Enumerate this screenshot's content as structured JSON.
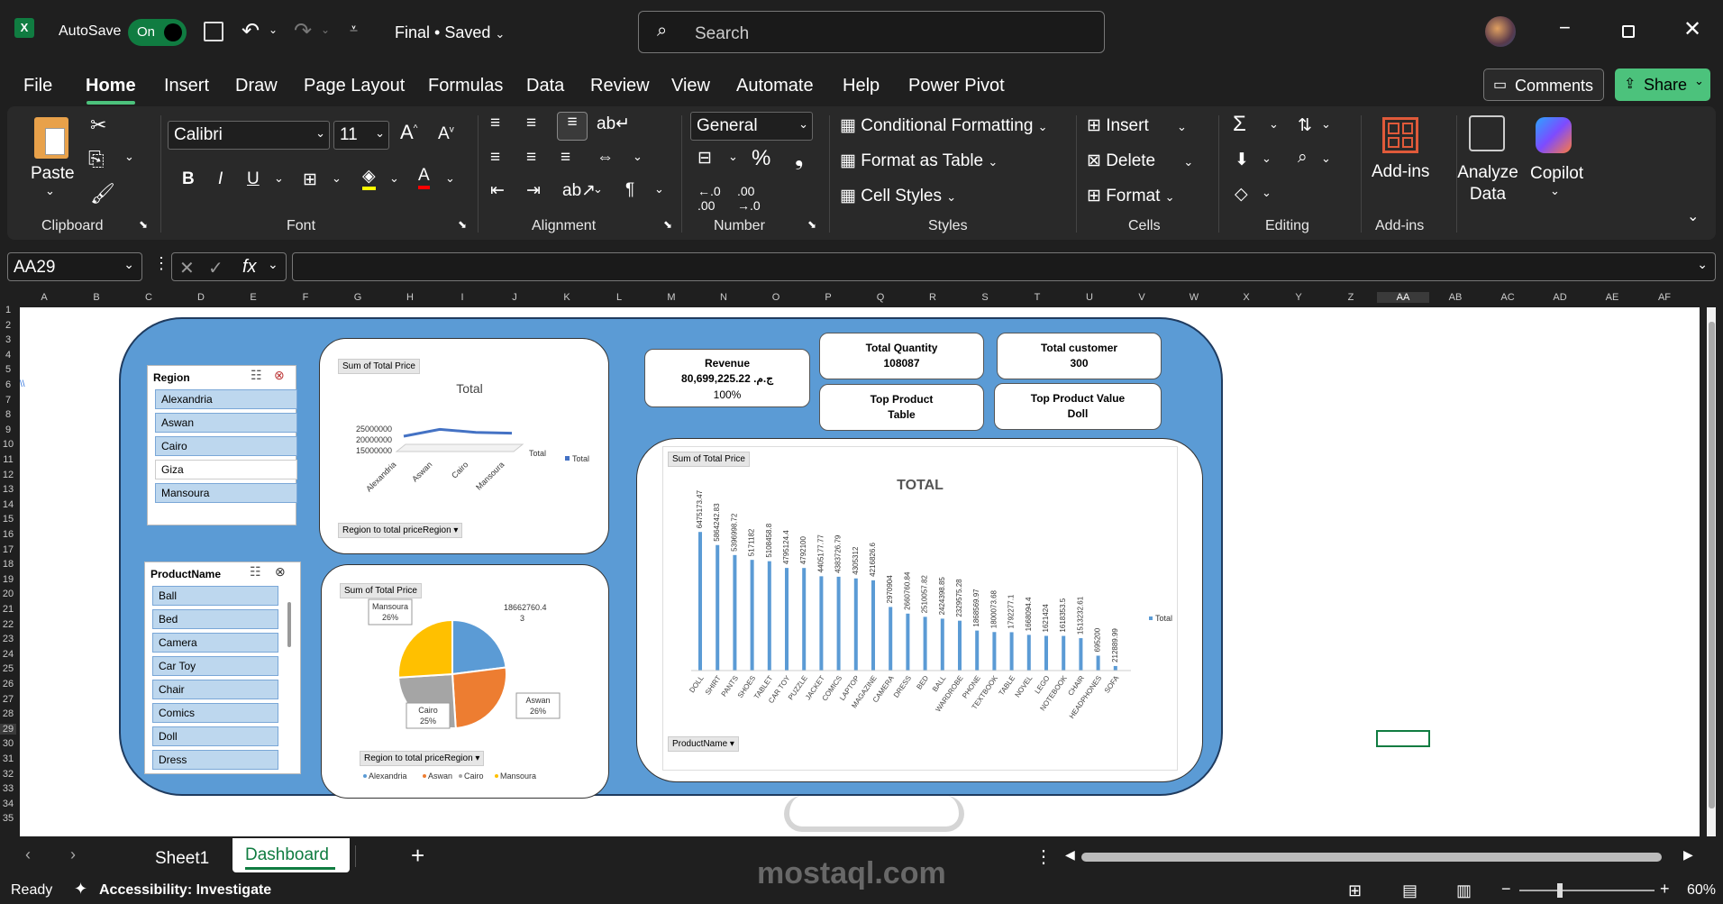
{
  "titlebar": {
    "autosave_label": "AutoSave",
    "toggle_state": "On",
    "doc_title": "Final • Saved",
    "search_placeholder": "Search"
  },
  "menu": [
    "File",
    "Home",
    "Insert",
    "Draw",
    "Page Layout",
    "Formulas",
    "Data",
    "Review",
    "View",
    "Automate",
    "Help",
    "Power Pivot"
  ],
  "menu_active": "Home",
  "actions": {
    "comments": "Comments",
    "share": "Share"
  },
  "ribbon": {
    "paste": "Paste",
    "font_name": "Calibri",
    "font_size": "11",
    "number_format": "General",
    "conditional_formatting": "Conditional Formatting",
    "format_as_table": "Format as Table",
    "cell_styles": "Cell Styles",
    "insert": "Insert",
    "delete": "Delete",
    "format": "Format",
    "add_ins": "Add-ins",
    "analyze_data": "Analyze Data",
    "copilot": "Copilot",
    "groups": {
      "clipboard": "Clipboard",
      "font": "Font",
      "alignment": "Alignment",
      "number": "Number",
      "styles": "Styles",
      "cells": "Cells",
      "editing": "Editing",
      "addins": "Add-ins"
    }
  },
  "formula_bar": {
    "name_box": "AA29",
    "fx": "fx",
    "formula": ""
  },
  "columns": [
    "A",
    "B",
    "C",
    "D",
    "E",
    "F",
    "G",
    "H",
    "I",
    "J",
    "K",
    "L",
    "M",
    "N",
    "O",
    "P",
    "Q",
    "R",
    "S",
    "T",
    "U",
    "V",
    "W",
    "X",
    "Y",
    "Z",
    "AA",
    "AB",
    "AC",
    "AD",
    "AE",
    "AF"
  ],
  "rows": [
    "1",
    "2",
    "3",
    "4",
    "5",
    "6",
    "7",
    "8",
    "9",
    "10",
    "11",
    "12",
    "13",
    "14",
    "15",
    "16",
    "17",
    "18",
    "19",
    "20",
    "21",
    "22",
    "23",
    "24",
    "25",
    "26",
    "27",
    "28",
    "29",
    "30",
    "31",
    "32",
    "33",
    "34",
    "35"
  ],
  "selected_cell": {
    "column": "AA",
    "row": "29"
  },
  "dashboard": {
    "region_slicer": {
      "title": "Region",
      "items": [
        "Alexandria",
        "Aswan",
        "Cairo",
        "Giza",
        "Mansoura"
      ],
      "selected": [
        "Alexandria",
        "Aswan",
        "Cairo",
        "Mansoura"
      ]
    },
    "product_slicer": {
      "title": "ProductName",
      "items": [
        "Ball",
        "Bed",
        "Camera",
        "Car Toy",
        "Chair",
        "Comics",
        "Doll",
        "Dress"
      ]
    },
    "kpis": {
      "revenue_label": "Revenue",
      "revenue_value": "80,699,225.22 ج.م.‏",
      "revenue_pct": "100%",
      "total_quantity_label": "Total Quantity",
      "total_quantity_value": "108087",
      "total_customer_label": "Total customer",
      "total_customer_value": "300",
      "top_product_label": "Top Product",
      "top_product_value": "Table",
      "top_product_value_label": "Top Product Value",
      "top_product_value_value": "Doll"
    },
    "line_chart_tag": "Sum of Total Price",
    "line_chart_filter": "Region to total priceRegion",
    "pie_chart_tag": "Sum of Total Price",
    "pie_chart_filter": "Region to total priceRegion",
    "bar_chart_tag": "Sum of Total Price",
    "bar_chart_filter": "ProductName"
  },
  "chart_data": [
    {
      "type": "line",
      "title": "Total",
      "categories": [
        "Alexandria",
        "Aswan",
        "Cairo",
        "Mansoura"
      ],
      "series": [
        {
          "name": "Total",
          "values": [
            18662760.43,
            21200000,
            20100000,
            19800000
          ]
        }
      ],
      "y_ticks": [
        "25000000",
        "20000000",
        "15000000"
      ],
      "ylim": [
        15000000,
        25000000
      ],
      "legend": "right",
      "color": "#4472c4"
    },
    {
      "type": "pie",
      "categories": [
        "Alexandria",
        "Aswan",
        "Cairo",
        "Mansoura"
      ],
      "values": [
        23,
        26,
        25,
        26
      ],
      "labels": [
        "18662760.4 3",
        "Aswan 26%",
        "Cairo 25%",
        "Mansoura 26%"
      ],
      "colors": [
        "#5b9bd5",
        "#ed7d31",
        "#a5a5a5",
        "#ffc000"
      ],
      "legend": "bottom"
    },
    {
      "type": "bar",
      "title": "TOTAL",
      "categories": [
        "DOLL",
        "SHIRT",
        "PANTS",
        "SHOES",
        "TABLET",
        "CAR TOY",
        "PUZZLE",
        "JACKET",
        "COMICS",
        "LAPTOP",
        "MAGAZINE",
        "CAMERA",
        "DRESS",
        "BED",
        "BALL",
        "WARDROBE",
        "PHONE",
        "TEXTBOOK",
        "TABLE",
        "NOVEL",
        "LEGO",
        "NOTEBOOK",
        "CHAIR",
        "HEADPHONES",
        "SOFA"
      ],
      "series": [
        {
          "name": "Total",
          "values": [
            6475173.47,
            5864242.83,
            5396998.72,
            5171182,
            5108458.8,
            4795124.4,
            4792100,
            4405177.77,
            4383726.79,
            4305312,
            4216826.6,
            2970904,
            2660760.84,
            2510057.82,
            2424398.85,
            2329575.28,
            1868569.97,
            1800073.68,
            1792277.1,
            1668094.4,
            1621424,
            1618353.5,
            1513232.61,
            695200,
            212889.99
          ]
        }
      ],
      "legend": "right",
      "color": "#5b9bd5"
    }
  ],
  "sheet_tabs": [
    "Sheet1",
    "Dashboard"
  ],
  "active_tab": "Dashboard",
  "status": {
    "ready": "Ready",
    "accessibility": "Accessibility: Investigate",
    "zoom": "60%"
  },
  "watermark": {
    "text": "mostaql.com"
  }
}
